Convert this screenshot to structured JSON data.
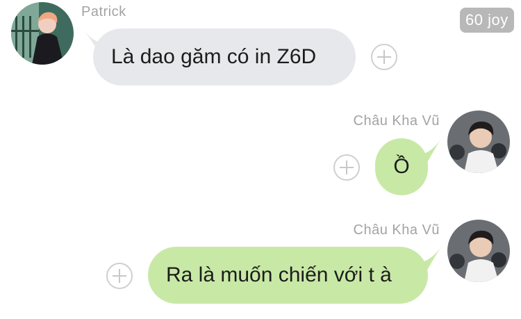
{
  "badge": {
    "text": "60 joy"
  },
  "messages": [
    {
      "sender": "Patrick",
      "text": "Là dao găm có in Z6D",
      "direction": "incoming"
    },
    {
      "sender": "Châu Kha Vũ",
      "text": "Ồ",
      "direction": "outgoing"
    },
    {
      "sender": "Châu Kha Vũ",
      "text": "Ra là muốn chiến với t à",
      "direction": "outgoing"
    }
  ],
  "colors": {
    "incoming_bubble": "#e6e8ec",
    "outgoing_bubble": "#c8e9a6",
    "sender_name": "#a3a3a3",
    "badge": "#b8b8b8"
  },
  "icons": {
    "add": "plus-circle-icon"
  }
}
